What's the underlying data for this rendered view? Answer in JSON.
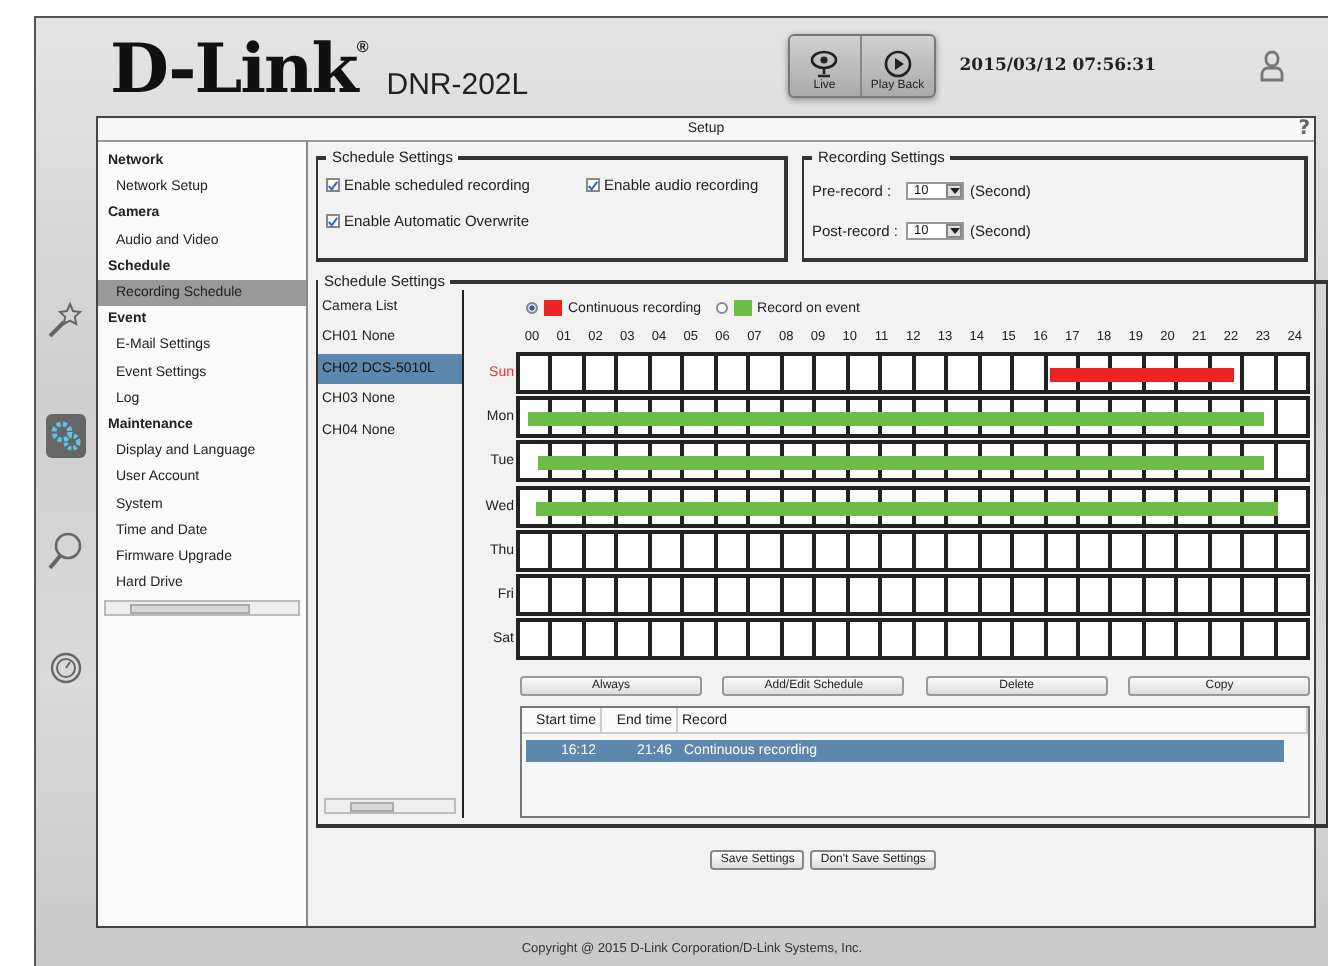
{
  "header": {
    "logo": "D-Link",
    "logo_mark": "®",
    "model": "DNR-202L",
    "nav_buttons": [
      {
        "label": "Live",
        "kind": "eye",
        "selected": false
      },
      {
        "label": "Play Back",
        "kind": "play",
        "selected": false
      }
    ],
    "datetime": "2015/03/12 07:56:31"
  },
  "side_icons": [
    {
      "kind": "wand",
      "selected": false
    },
    {
      "kind": "gears",
      "selected": true
    },
    {
      "kind": "search",
      "selected": false
    },
    {
      "kind": "gauge",
      "selected": false
    }
  ],
  "panel": {
    "title": "Setup",
    "help": "?"
  },
  "menu": [
    {
      "label": "Network",
      "kind": "heading",
      "selected": false
    },
    {
      "label": "Network Setup",
      "kind": "item",
      "selected": false
    },
    {
      "label": "Camera",
      "kind": "heading",
      "selected": false
    },
    {
      "label": "Audio and Video",
      "kind": "item",
      "selected": false
    },
    {
      "label": "Schedule",
      "kind": "heading",
      "selected": false
    },
    {
      "label": "Recording Schedule",
      "kind": "item",
      "selected": true
    },
    {
      "label": "Event",
      "kind": "heading",
      "selected": false
    },
    {
      "label": "E-Mail Settings",
      "kind": "item",
      "selected": false
    },
    {
      "label": "Event Settings",
      "kind": "item",
      "selected": false
    },
    {
      "label": "Log",
      "kind": "item",
      "selected": false
    },
    {
      "label": "Maintenance",
      "kind": "heading",
      "selected": false
    },
    {
      "label": "Display and Language",
      "kind": "item",
      "selected": false
    },
    {
      "label": "User Account",
      "kind": "item",
      "selected": false
    },
    {
      "label": "System",
      "kind": "item",
      "selected": false
    },
    {
      "label": "Time and Date",
      "kind": "item",
      "selected": false
    },
    {
      "label": "Firmware Upgrade",
      "kind": "item",
      "selected": false
    },
    {
      "label": "Hard Drive",
      "kind": "item",
      "selected": false
    }
  ],
  "schedule_settings": {
    "legend": "Schedule Settings",
    "options": [
      {
        "label": "Enable scheduled recording",
        "checked": true
      },
      {
        "label": "Enable audio recording",
        "checked": true
      },
      {
        "label": "Enable Automatic Overwrite",
        "checked": true
      }
    ]
  },
  "recording_settings": {
    "legend": "Recording Settings",
    "fields": [
      {
        "label": "Pre-record :",
        "value": "10",
        "unit": "(Second)"
      },
      {
        "label": "Post-record :",
        "value": "10",
        "unit": "(Second)"
      }
    ]
  },
  "schedule": {
    "legend": "Schedule Settings",
    "camera_list_title": "Camera List",
    "cameras": [
      {
        "label": "CH01 None",
        "selected": false
      },
      {
        "label": "CH02 DCS-5010L",
        "selected": true
      },
      {
        "label": "CH03 None",
        "selected": false
      },
      {
        "label": "CH04 None",
        "selected": false
      }
    ],
    "modes": [
      {
        "kind": "continuous",
        "label": "Continuous recording",
        "color": "#ee2222",
        "selected": true
      },
      {
        "kind": "event",
        "label": "Record on event",
        "color": "#6cbd45",
        "selected": false
      }
    ],
    "hours": [
      "00",
      "01",
      "02",
      "03",
      "04",
      "05",
      "06",
      "07",
      "08",
      "09",
      "10",
      "11",
      "12",
      "13",
      "14",
      "15",
      "16",
      "17",
      "18",
      "19",
      "20",
      "21",
      "22",
      "23",
      "24"
    ],
    "days": [
      {
        "name": "Sun",
        "selected": true,
        "bars": [
          {
            "kind": "continuous",
            "start": {
              "level": 0.675
            },
            "level": 0.907
          }
        ]
      },
      {
        "name": "Mon",
        "selected": false,
        "bars": [
          {
            "kind": "event",
            "start": {
              "level": 0.01
            },
            "level": 0.945
          }
        ]
      },
      {
        "name": "Tue",
        "selected": false,
        "bars": [
          {
            "kind": "event",
            "start": {
              "level": 0.024
            },
            "level": 0.945
          }
        ]
      },
      {
        "name": "Wed",
        "selected": false,
        "bars": [
          {
            "kind": "event",
            "start": {
              "level": 0.021
            },
            "level": 0.965
          }
        ]
      },
      {
        "name": "Thu",
        "selected": false
      },
      {
        "name": "Fri",
        "selected": false
      },
      {
        "name": "Sat",
        "selected": false
      }
    ],
    "actions": [
      "Always",
      "Add/Edit Schedule",
      "Delete",
      "Copy"
    ],
    "table": {
      "columns": [
        "Start time",
        "End time",
        "Record"
      ],
      "rows": [
        {
          "cells": [
            "16:12",
            "21:46",
            "Continuous recording"
          ],
          "selected": true
        }
      ]
    }
  },
  "buttons": [
    "Save Settings",
    "Don't Save Settings"
  ],
  "footer": "Copyright @ 2015 D-Link Corporation/D-Link Systems, Inc."
}
